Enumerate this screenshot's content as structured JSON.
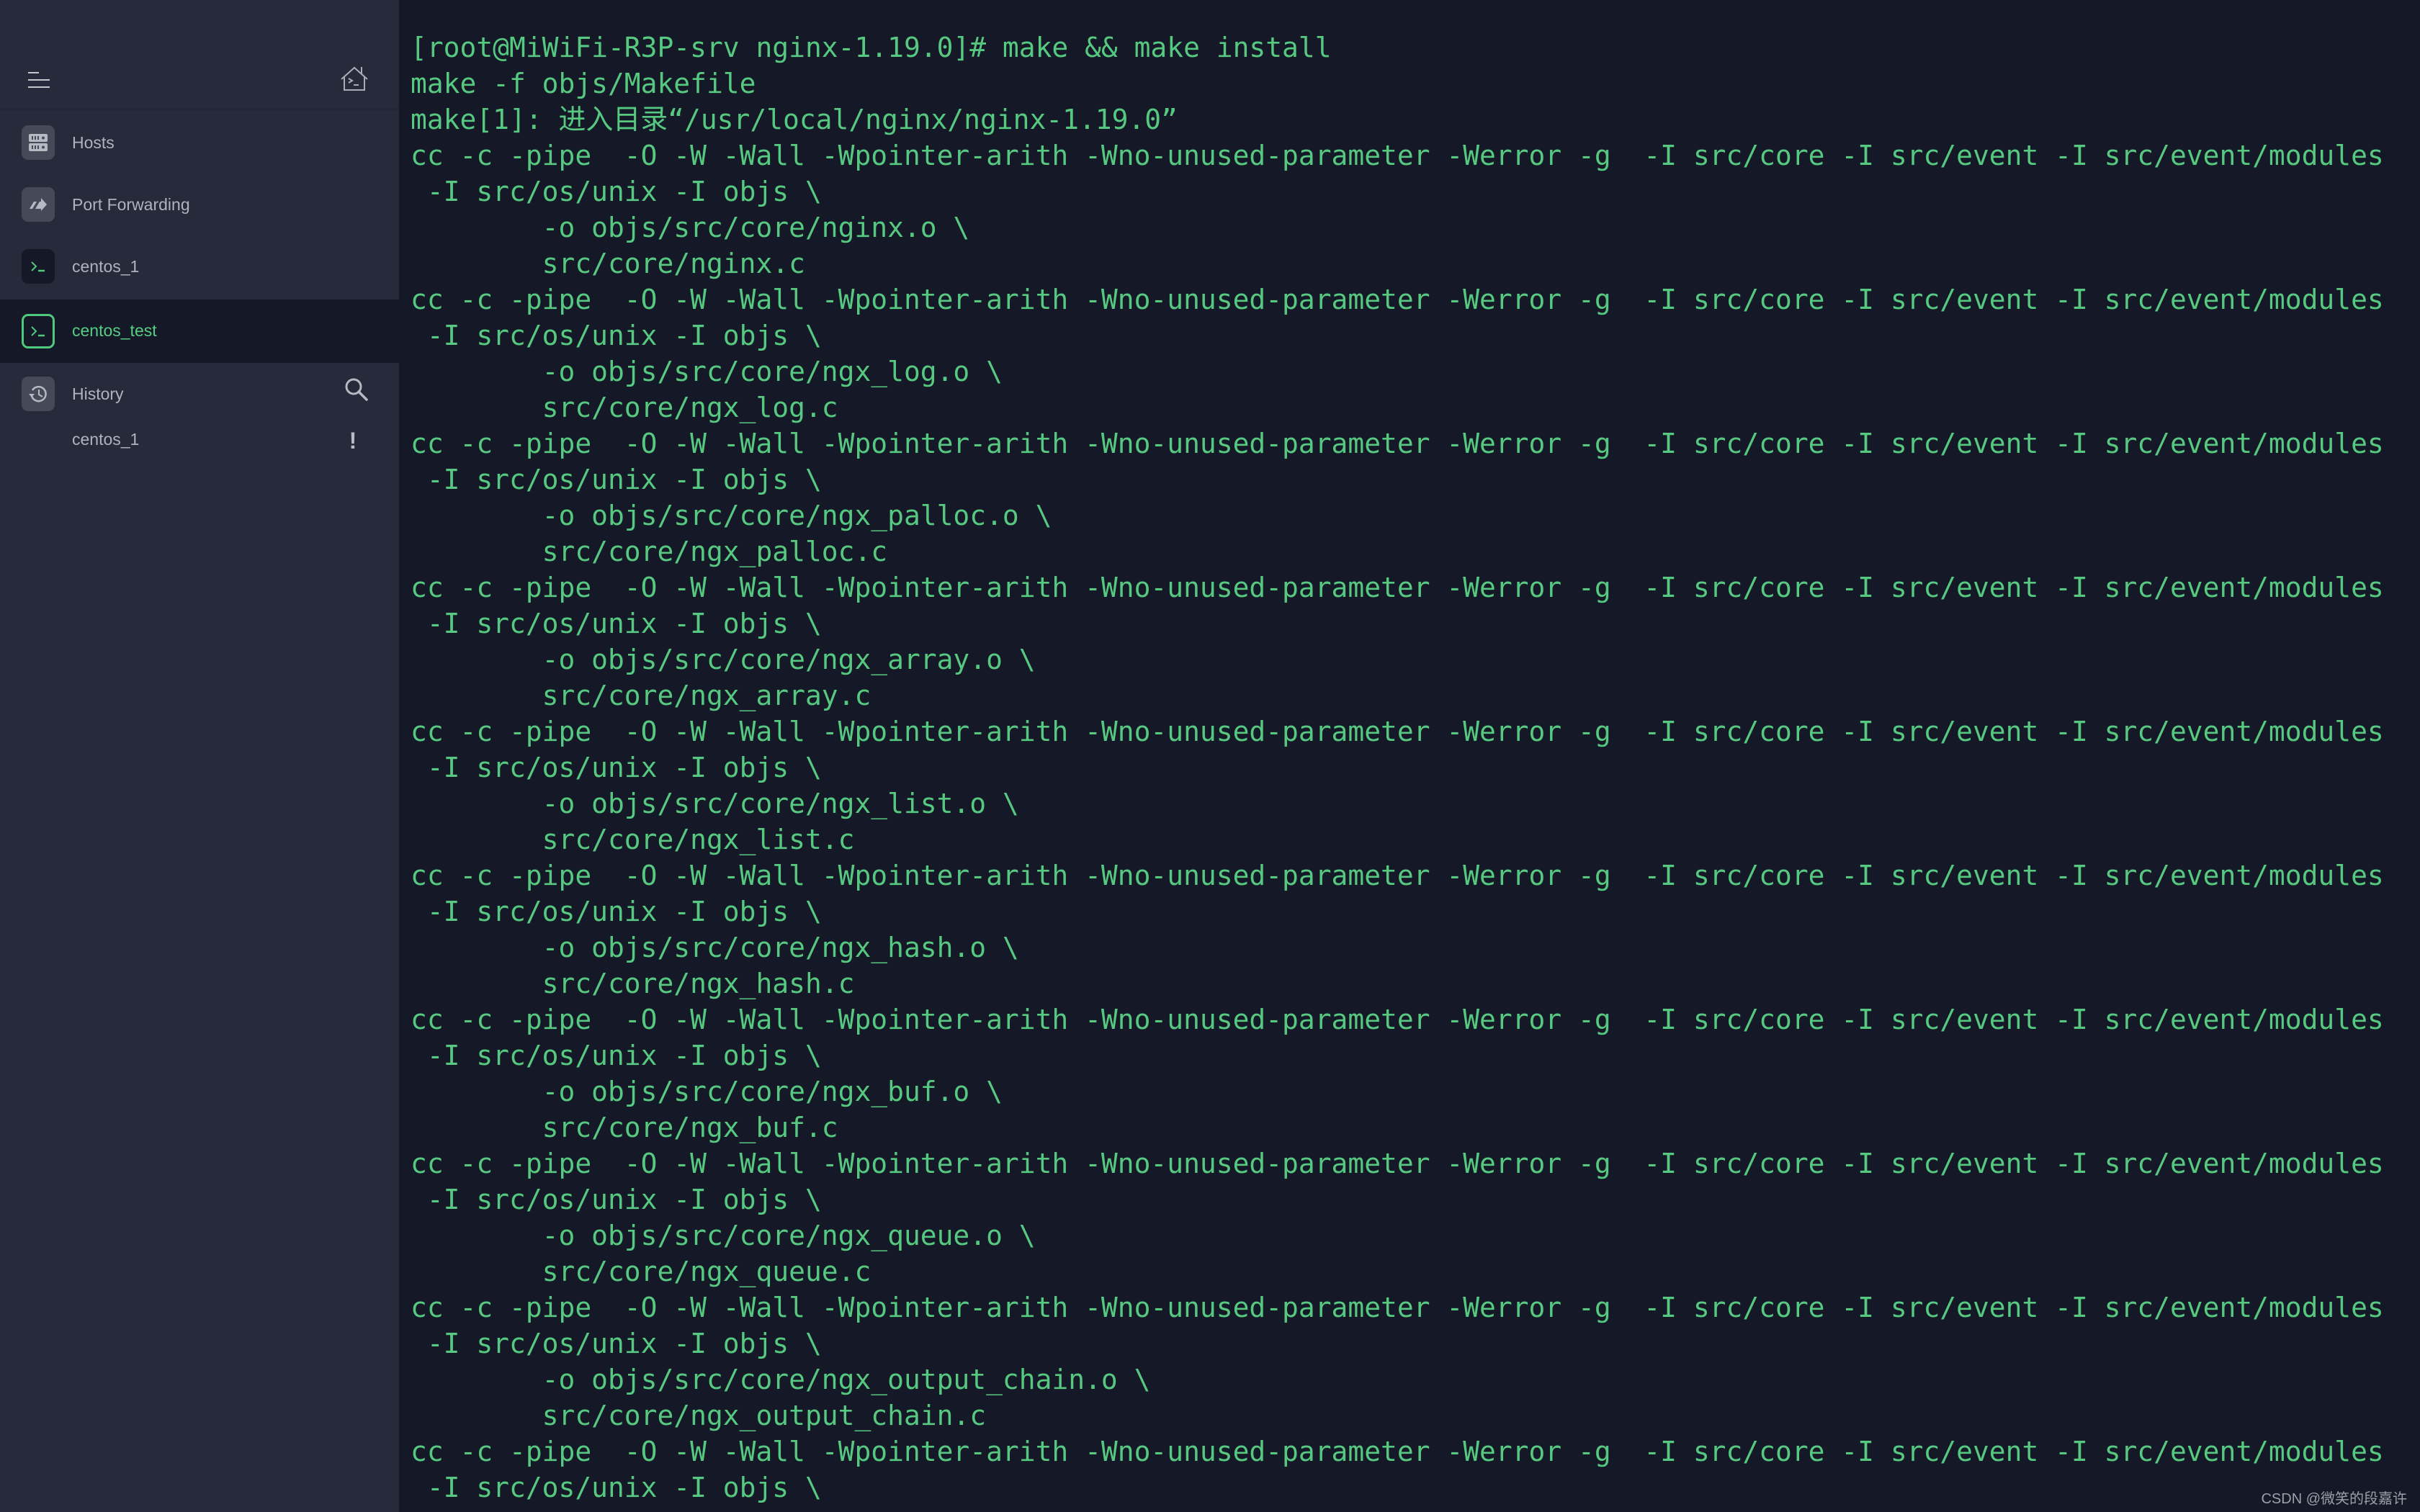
{
  "sidebar": {
    "header": {
      "menu_icon": "menu-icon",
      "home_icon": "home-terminal-icon"
    },
    "nav_items": [
      {
        "label": "Hosts",
        "icon": "hosts-server-icon"
      },
      {
        "label": "Port Forwarding",
        "icon": "port-forwarding-icon"
      },
      {
        "label": "centos_1",
        "icon": "terminal-icon"
      },
      {
        "label": "centos_test",
        "icon": "terminal-icon",
        "active": true
      }
    ],
    "history": {
      "label": "History",
      "icon": "history-icon",
      "search_icon": "search-icon",
      "items": [
        {
          "label": "centos_1",
          "status_icon": "alert-icon",
          "status_text": "!"
        }
      ]
    }
  },
  "terminal": {
    "lines": [
      "[root@MiWiFi-R3P-srv nginx-1.19.0]# make && make install",
      "make -f objs/Makefile",
      "make[1]: 进入目录“/usr/local/nginx/nginx-1.19.0”",
      "cc -c -pipe  -O -W -Wall -Wpointer-arith -Wno-unused-parameter -Werror -g  -I src/core -I src/event -I src/event/modules",
      " -I src/os/unix -I objs \\",
      "        -o objs/src/core/nginx.o \\",
      "        src/core/nginx.c",
      "cc -c -pipe  -O -W -Wall -Wpointer-arith -Wno-unused-parameter -Werror -g  -I src/core -I src/event -I src/event/modules",
      " -I src/os/unix -I objs \\",
      "        -o objs/src/core/ngx_log.o \\",
      "        src/core/ngx_log.c",
      "cc -c -pipe  -O -W -Wall -Wpointer-arith -Wno-unused-parameter -Werror -g  -I src/core -I src/event -I src/event/modules",
      " -I src/os/unix -I objs \\",
      "        -o objs/src/core/ngx_palloc.o \\",
      "        src/core/ngx_palloc.c",
      "cc -c -pipe  -O -W -Wall -Wpointer-arith -Wno-unused-parameter -Werror -g  -I src/core -I src/event -I src/event/modules",
      " -I src/os/unix -I objs \\",
      "        -o objs/src/core/ngx_array.o \\",
      "        src/core/ngx_array.c",
      "cc -c -pipe  -O -W -Wall -Wpointer-arith -Wno-unused-parameter -Werror -g  -I src/core -I src/event -I src/event/modules",
      " -I src/os/unix -I objs \\",
      "        -o objs/src/core/ngx_list.o \\",
      "        src/core/ngx_list.c",
      "cc -c -pipe  -O -W -Wall -Wpointer-arith -Wno-unused-parameter -Werror -g  -I src/core -I src/event -I src/event/modules",
      " -I src/os/unix -I objs \\",
      "        -o objs/src/core/ngx_hash.o \\",
      "        src/core/ngx_hash.c",
      "cc -c -pipe  -O -W -Wall -Wpointer-arith -Wno-unused-parameter -Werror -g  -I src/core -I src/event -I src/event/modules",
      " -I src/os/unix -I objs \\",
      "        -o objs/src/core/ngx_buf.o \\",
      "        src/core/ngx_buf.c",
      "cc -c -pipe  -O -W -Wall -Wpointer-arith -Wno-unused-parameter -Werror -g  -I src/core -I src/event -I src/event/modules",
      " -I src/os/unix -I objs \\",
      "        -o objs/src/core/ngx_queue.o \\",
      "        src/core/ngx_queue.c",
      "cc -c -pipe  -O -W -Wall -Wpointer-arith -Wno-unused-parameter -Werror -g  -I src/core -I src/event -I src/event/modules",
      " -I src/os/unix -I objs \\",
      "        -o objs/src/core/ngx_output_chain.o \\",
      "        src/core/ngx_output_chain.c",
      "cc -c -pipe  -O -W -Wall -Wpointer-arith -Wno-unused-parameter -Werror -g  -I src/core -I src/event -I src/event/modules",
      " -I src/os/unix -I objs \\"
    ],
    "text_color": "#56c880",
    "background": "#141827"
  },
  "watermark": "CSDN @微笑的段嘉许",
  "colors": {
    "sidebar_bg": "#272a3a",
    "selected_bg": "#151827",
    "accent_green": "#56cd82",
    "icon_box": "#454a58",
    "label_gray": "#aeb4bd"
  }
}
